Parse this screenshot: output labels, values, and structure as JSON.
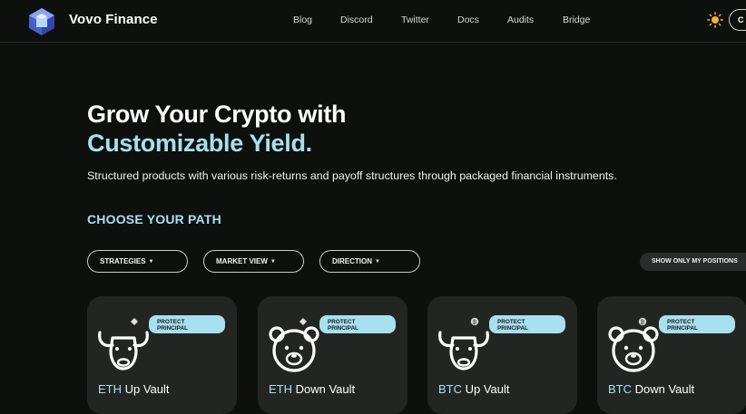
{
  "header": {
    "brand": "Vovo Finance",
    "nav": [
      "Blog",
      "Discord",
      "Twitter",
      "Docs",
      "Audits",
      "Bridge"
    ],
    "theme_toggle_icon": "sun-icon",
    "connect_label": "C"
  },
  "hero": {
    "line1": "Grow Your Crypto with",
    "line2": "Customizable Yield.",
    "subtitle": "Structured products with various risk-returns and payoff structures through packaged financial instruments."
  },
  "section": {
    "title": "CHOOSE YOUR PATH"
  },
  "filters": {
    "strategies": "STRATEGIES",
    "market_view": "MARKET VIEW",
    "direction": "DIRECTION",
    "show_positions": "SHOW ONLY MY POSITIONS"
  },
  "vaults": [
    {
      "asset": "ETH",
      "direction": "Up Vault",
      "badge_line1": "PROTECT",
      "badge_line2": "PRINCIPAL",
      "animal": "bull-icon",
      "coin": "eth-icon"
    },
    {
      "asset": "ETH",
      "direction": "Down Vault",
      "badge_line1": "PROTECT",
      "badge_line2": "PRINCIPAL",
      "animal": "bear-icon",
      "coin": "eth-icon"
    },
    {
      "asset": "BTC",
      "direction": "Up Vault",
      "badge_line1": "PROTECT",
      "badge_line2": "PRINCIPAL",
      "animal": "bull-icon",
      "coin": "btc-icon"
    },
    {
      "asset": "BTC",
      "direction": "Down Vault",
      "badge_line1": "PROTECT",
      "badge_line2": "PRINCIPAL",
      "animal": "bear-icon",
      "coin": "btc-icon"
    }
  ],
  "colors": {
    "background": "#0e100e",
    "accent": "#a7e0ef",
    "card": "#232523"
  }
}
